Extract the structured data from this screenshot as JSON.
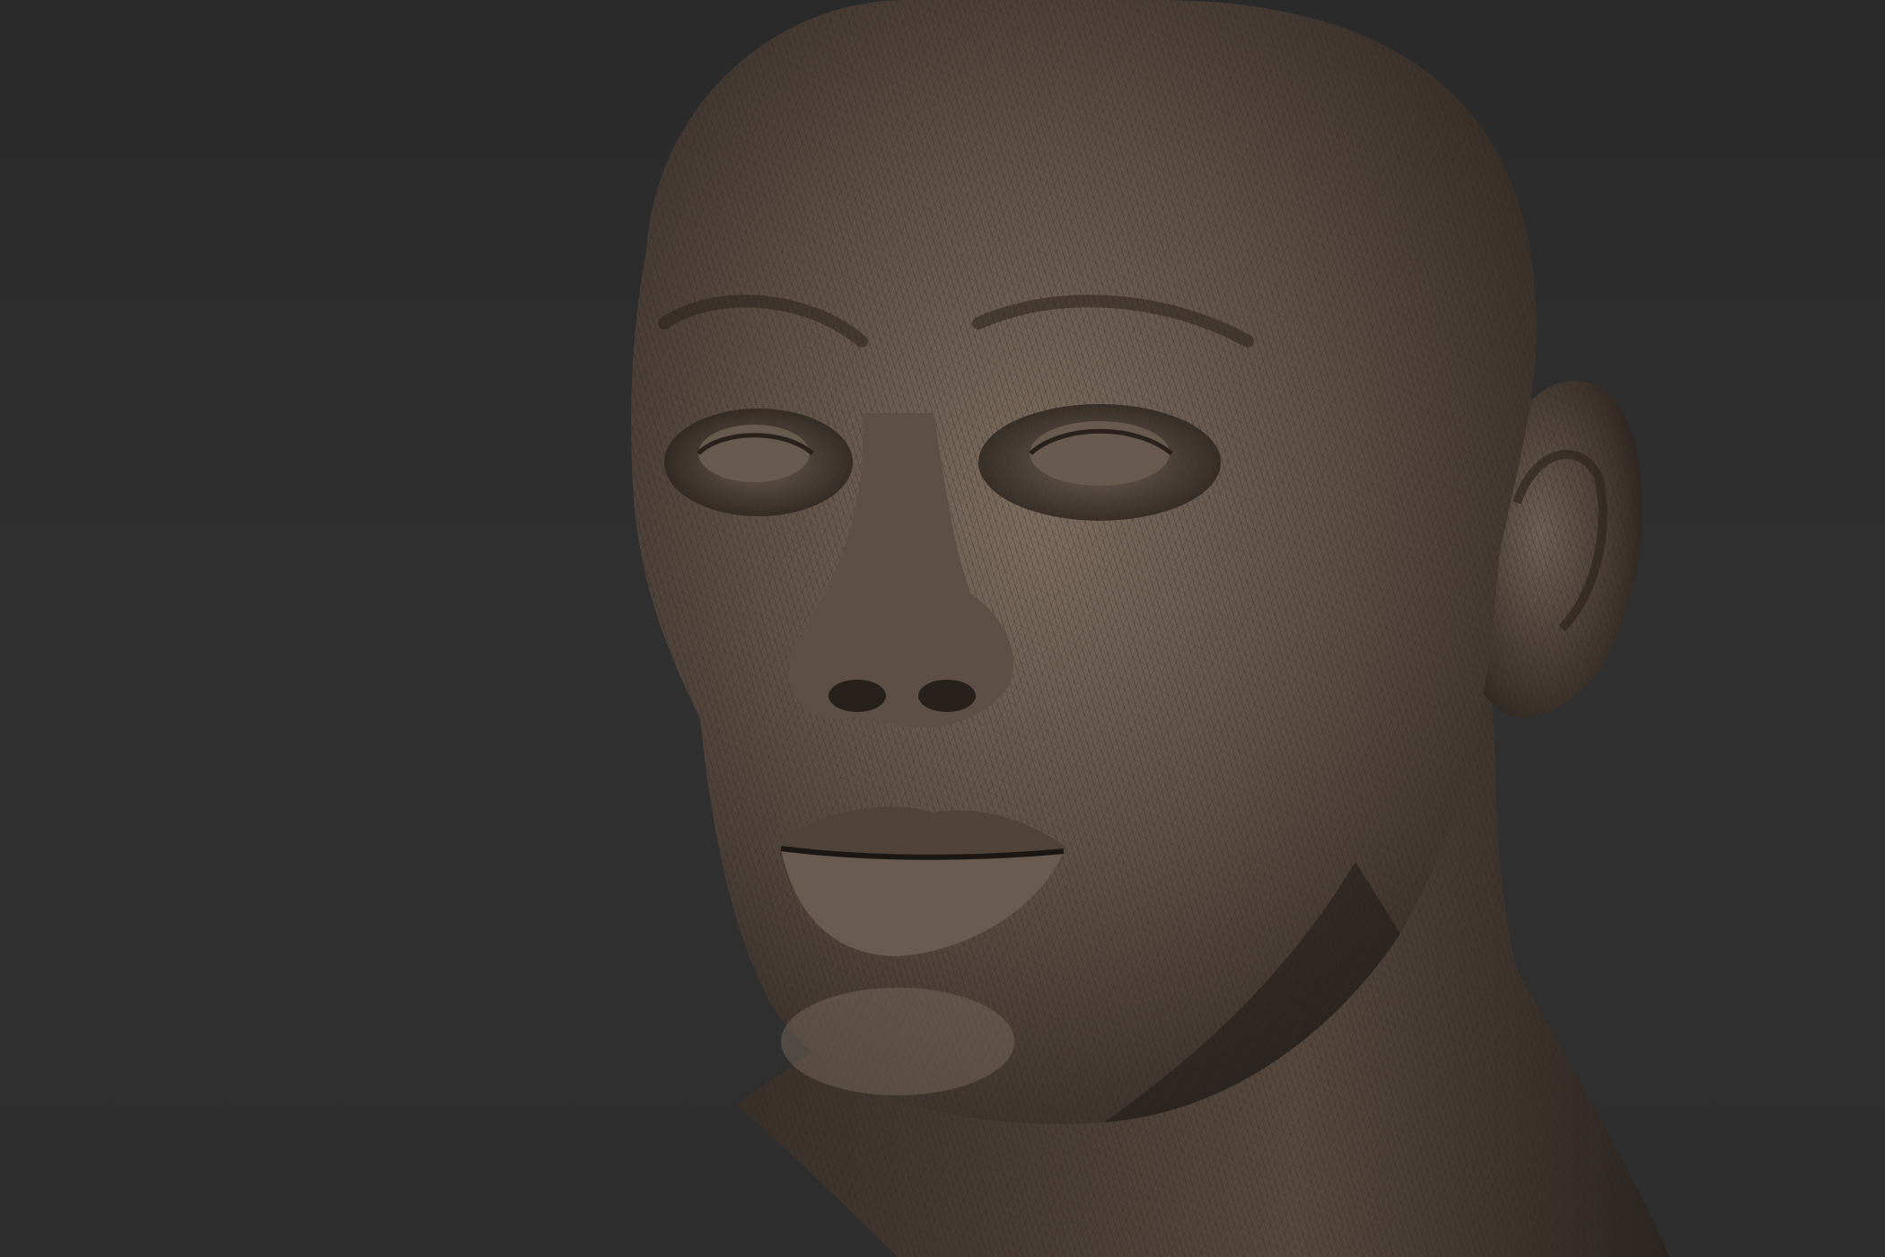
{
  "viewport": {
    "background_color": "#2b2b2b",
    "model_base_color": "#5a4d43",
    "model_highlight_color": "#8a7a6c",
    "model_shadow_color": "#1d1713",
    "wireframe_color": "#2a221d"
  },
  "model": {
    "subject": "sculpted-head-mesh",
    "icon": "polymesh-icon"
  }
}
